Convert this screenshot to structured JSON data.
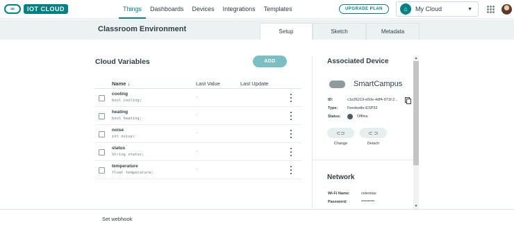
{
  "brand": {
    "logo_mark": "∞",
    "logo_text": "IOT CLOUD",
    "accent_color": "#008184"
  },
  "nav": {
    "items": [
      {
        "label": "Things",
        "active": true
      },
      {
        "label": "Dashboards"
      },
      {
        "label": "Devices"
      },
      {
        "label": "Integrations"
      },
      {
        "label": "Templates"
      }
    ],
    "upgrade_label": "UPGRADE PLAN",
    "space_label": "My Cloud",
    "space_icon": "home-icon",
    "apps_icon": "grid-icon"
  },
  "thing": {
    "title": "Classroom Environment",
    "tabs": [
      {
        "label": "Setup",
        "active": true
      },
      {
        "label": "Sketch"
      },
      {
        "label": "Metadata"
      }
    ]
  },
  "variables": {
    "title": "Cloud Variables",
    "add_label": "ADD",
    "columns": {
      "name": "Name ↓",
      "last_value": "Last Value",
      "last_update": "Last Update"
    },
    "rows": [
      {
        "name": "cooling",
        "decl": "bool cooling;",
        "last_value": "-"
      },
      {
        "name": "heating",
        "decl": "bool heating;",
        "last_value": "-"
      },
      {
        "name": "noise",
        "decl": "int noise;",
        "last_value": "-"
      },
      {
        "name": "status",
        "decl": "String status;",
        "last_value": "-"
      },
      {
        "name": "temperature",
        "decl": "float temperature;",
        "last_value": "-"
      }
    ]
  },
  "device": {
    "title": "Associated Device",
    "name": "SmartCampus",
    "id_label": "ID:",
    "id_value": "c1e26219-e50e-4df4-971f-2...",
    "type_label": "Type:",
    "type_value": "Feedeetle-ESP32",
    "status_label": "Status:",
    "status_value": "Offline",
    "change_label": "Change",
    "detach_label": "Detach",
    "change_icon": "link-icon",
    "detach_icon": "unlink-icon"
  },
  "network": {
    "title": "Network",
    "wifi_label": "Wi-Fi Name:",
    "wifi_value": "celenitas",
    "password_label": "Password:",
    "password_value": "••••••••••"
  },
  "footer": {
    "webhook_label": "Set webhook"
  }
}
